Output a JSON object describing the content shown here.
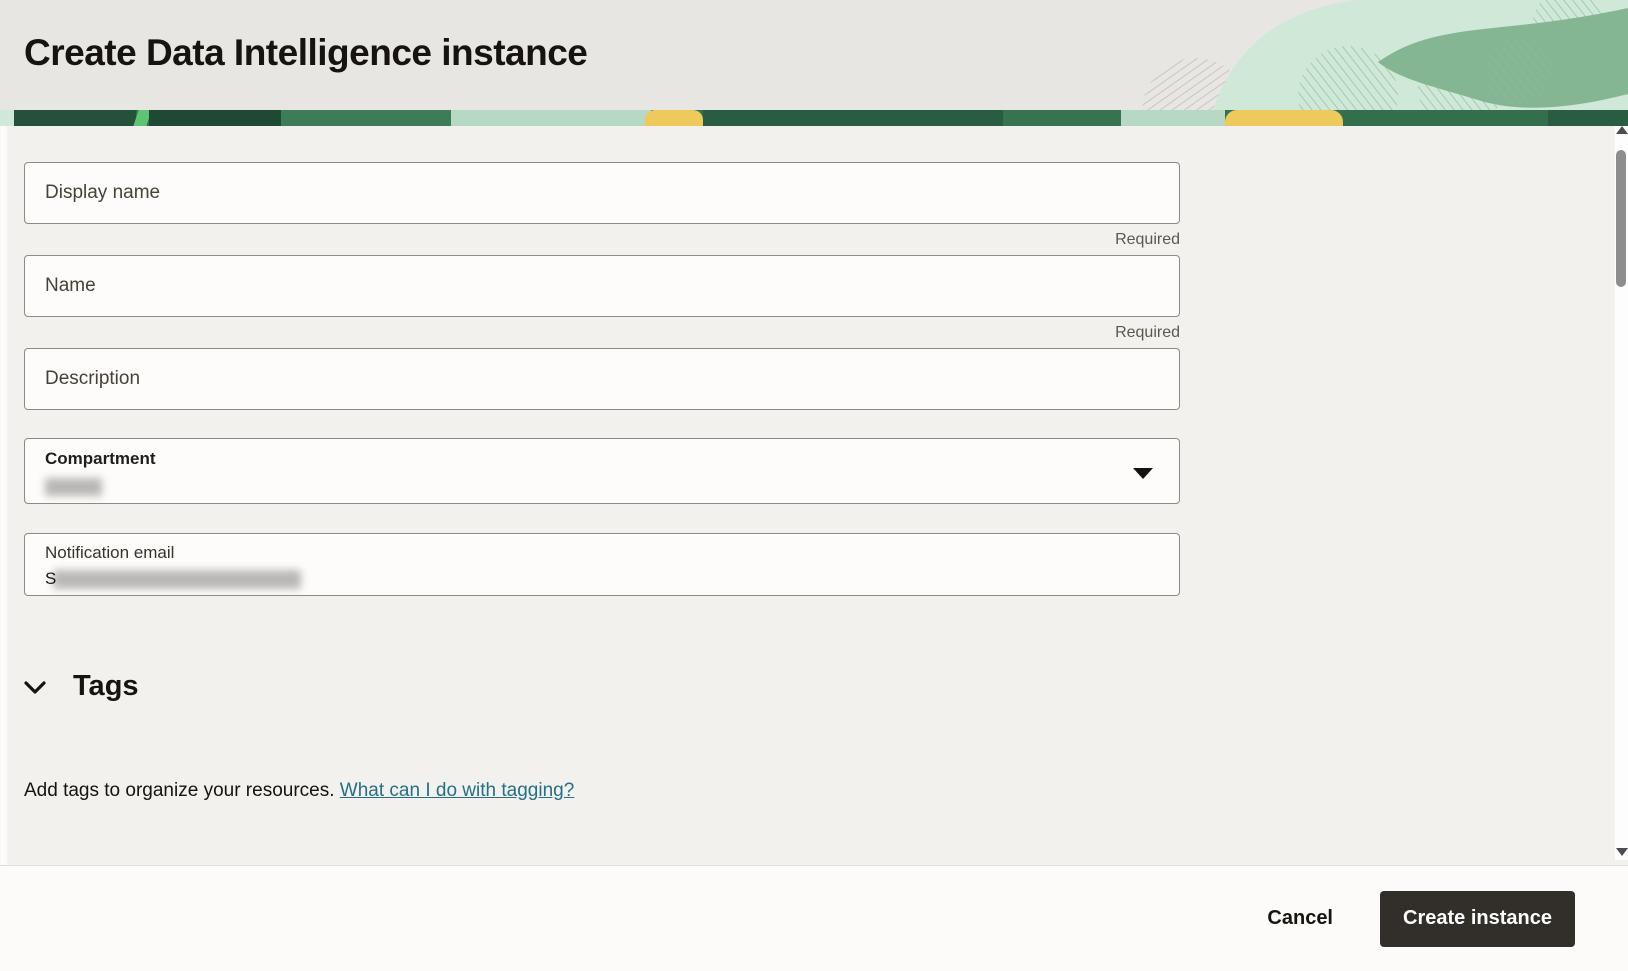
{
  "header": {
    "title": "Create Data Intelligence instance"
  },
  "form": {
    "display_name": {
      "label": "Display name",
      "value": "",
      "required_note": "Required"
    },
    "name": {
      "label": "Name",
      "value": "",
      "required_note": "Required"
    },
    "description": {
      "label": "Description",
      "value": ""
    },
    "compartment": {
      "label": "Compartment",
      "value_redacted": true
    },
    "notification_email": {
      "label": "Notification email",
      "visible_prefix": "S",
      "value_redacted": true
    }
  },
  "tags_section": {
    "heading": "Tags",
    "description": "Add tags to organize your resources. ",
    "link_label": "What can I do with tagging?"
  },
  "footer": {
    "cancel_label": "Cancel",
    "create_label": "Create instance"
  },
  "icons": {
    "tags_collapse": "chevron-down-icon",
    "compartment_dropdown": "caret-down-icon",
    "scrollbar_up": "triangle-up-icon",
    "scrollbar_down": "triangle-down-icon"
  },
  "colors": {
    "header_bg": "#e8e6e2",
    "panel_bg": "#f2f1ee",
    "banner_green_dark": "#1e4a34",
    "banner_green_mid": "#35714e",
    "banner_mint": "#cfe8d8",
    "banner_yellow": "#eec95c",
    "banner_bright_green": "#5ec473",
    "input_border": "#8f8a85",
    "input_bg": "#fdfcfa",
    "link": "#256f87",
    "primary_button_bg": "#322e2a",
    "primary_button_text": "#ffffff",
    "text_primary": "#17130e",
    "text_muted": "#5d574e"
  }
}
